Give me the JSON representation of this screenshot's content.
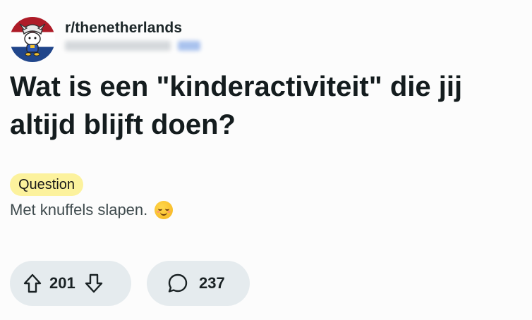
{
  "post": {
    "subreddit": "r/thenetherlands",
    "title": "Wat is een \"kinderactiviteit\" die jij altijd blijft doen?",
    "flair": "Question",
    "body": "Met knuffels slapen.",
    "emoji": "relieved-smiling-face"
  },
  "actions": {
    "upvotes": "201",
    "comments": "237"
  },
  "colors": {
    "flag_red": "#ae1c28",
    "flag_white": "#ffffff",
    "flag_blue": "#21468b",
    "flair_bg": "#fcf29d",
    "pill_bg": "#e5ebee"
  }
}
